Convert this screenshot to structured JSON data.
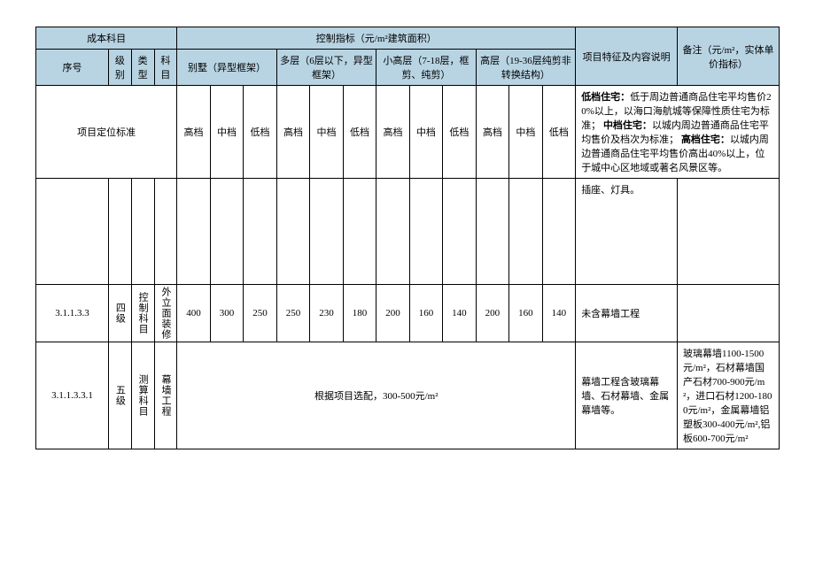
{
  "header": {
    "cost_subject": "成本科目",
    "control_indicator": "控制指标（元/m²建筑面积）",
    "desc": "项目特征及内容说明",
    "note": "备注（元/m²，实体单价指标）",
    "seq": "序号",
    "level": "级别",
    "type": "类型",
    "subject": "科目",
    "cat1": "别墅（异型框架）",
    "cat2": "多层（6层以下，异型框架）",
    "cat3": "小高层（7-18层，框剪、纯剪）",
    "cat4": "高层（19-36层纯剪非转换结构）"
  },
  "posrow": {
    "label": "项目定位标准",
    "high": "高档",
    "mid": "中档",
    "low": "低档",
    "note_low_b": "低档住宅：",
    "note_low_t": "低于周边普通商品住宅平均售价20%以上，以海口海航城等保障性质住宅为标准；",
    "note_mid_b": "中档住宅：",
    "note_mid_t": "以城内周边普通商品住宅平均售价及档次为标准；",
    "note_high_b": "高档住宅：",
    "note_high_t": "以城内周边普通商品住宅平均售价高出40%以上，位于城中心区地域或著名风景区等。"
  },
  "row_topnote": {
    "desc": "插座、灯具。"
  },
  "row_a": {
    "seq": "3.1.1.3.3",
    "level": "四级",
    "type": "控制科目",
    "subject": "外立面装修",
    "v": [
      "400",
      "300",
      "250",
      "250",
      "230",
      "180",
      "200",
      "160",
      "140",
      "200",
      "160",
      "140"
    ],
    "desc": "未含幕墙工程"
  },
  "row_b": {
    "seq": "3.1.1.3.3.1",
    "level": "五级",
    "type": "测算科目",
    "subject": "幕墙工程",
    "merged": "根据项目选配，300-500元/m²",
    "desc": "幕墙工程含玻璃幕墙、石材幕墙、金属幕墙等。",
    "note": "玻璃幕墙1100-1500元/m²，石材幕墙国产石材700-900元/m²，进口石材1200-1800元/m²，金属幕墙铝塑板300-400元/m²,铝板600-700元/m²"
  }
}
